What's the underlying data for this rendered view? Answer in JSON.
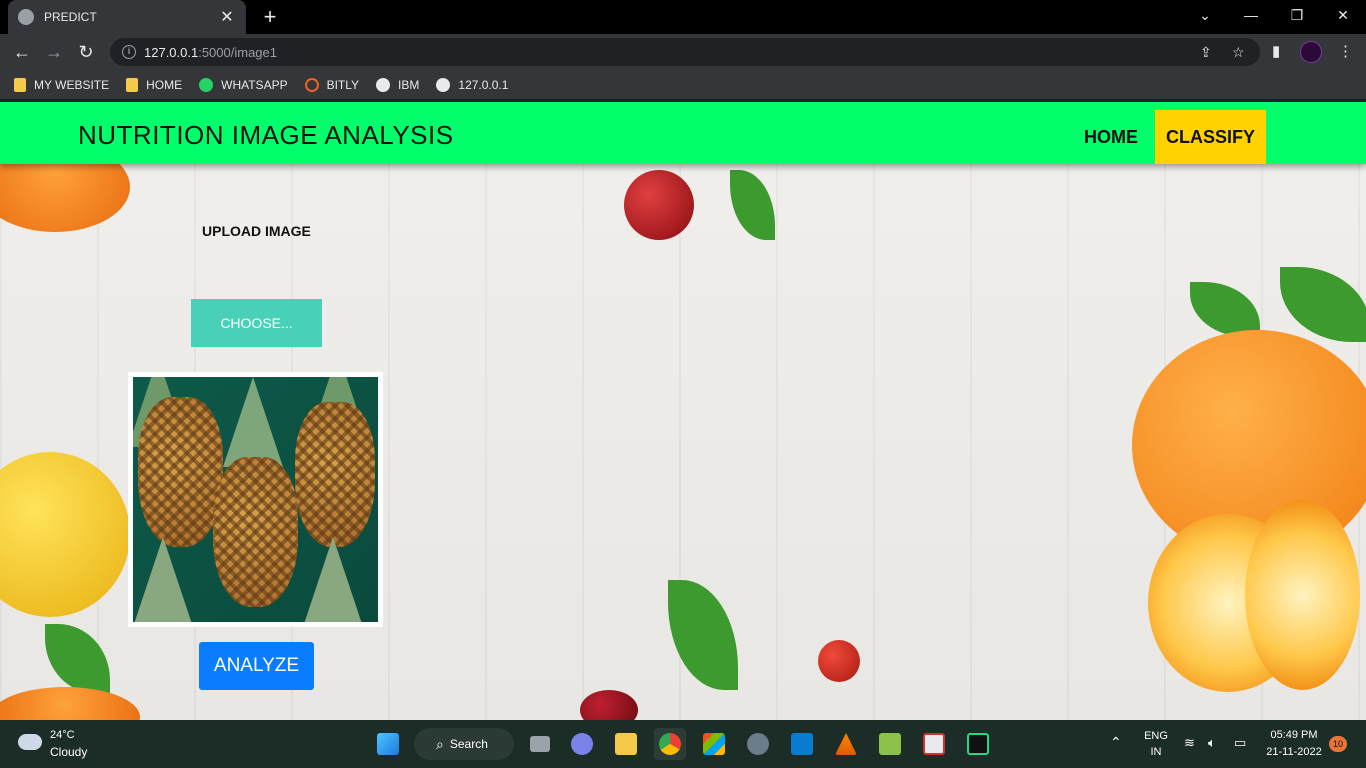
{
  "browser": {
    "tab_title": "PREDICT",
    "url_host": "127.0.0.1",
    "url_path": ":5000/image1",
    "bookmarks": [
      {
        "label": "MY WEBSITE",
        "icon": "folder-icon"
      },
      {
        "label": "HOME",
        "icon": "folder-icon"
      },
      {
        "label": "WHATSAPP",
        "icon": "whatsapp-icon"
      },
      {
        "label": "BITLY",
        "icon": "bitly-icon"
      },
      {
        "label": "IBM",
        "icon": "globe-icon"
      },
      {
        "label": "127.0.0.1",
        "icon": "globe-icon"
      }
    ]
  },
  "navbar": {
    "brand": "NUTRITION IMAGE ANALYSIS",
    "home": "HOME",
    "classify": "CLASSIFY",
    "bg_color": "#00ff6a",
    "active_color": "#ffd200"
  },
  "main": {
    "upload_label": "UPLOAD IMAGE",
    "choose_button": "CHOOSE...",
    "analyze_button": "ANALYZE"
  },
  "taskbar": {
    "temperature": "24°C",
    "weather": "Cloudy",
    "search_label": "Search",
    "language": "ENG",
    "region": "IN",
    "time": "05:49 PM",
    "date": "21-11-2022",
    "notifications": "10"
  }
}
